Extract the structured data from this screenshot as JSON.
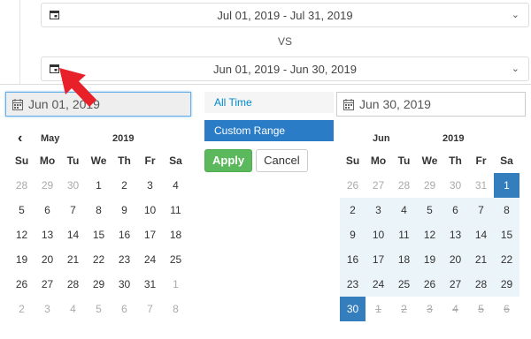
{
  "compare": {
    "range1": "Jul 01, 2019 - Jul 31, 2019",
    "vs": "VS",
    "range2": "Jun 01, 2019 - Jun 30, 2019"
  },
  "picker": {
    "start_input": "Jun 01, 2019",
    "end_input": "Jun 30, 2019",
    "ranges": [
      "All Time",
      "Custom Range"
    ],
    "apply_label": "Apply",
    "cancel_label": "Cancel",
    "left": {
      "month": "May",
      "year": "2019",
      "weekdays": [
        "Su",
        "Mo",
        "Tu",
        "We",
        "Th",
        "Fr",
        "Sa"
      ],
      "weeks": [
        [
          "28",
          "29",
          "30",
          "1",
          "2",
          "3",
          "4"
        ],
        [
          "5",
          "6",
          "7",
          "8",
          "9",
          "10",
          "11"
        ],
        [
          "12",
          "13",
          "14",
          "15",
          "16",
          "17",
          "18"
        ],
        [
          "19",
          "20",
          "21",
          "22",
          "23",
          "24",
          "25"
        ],
        [
          "26",
          "27",
          "28",
          "29",
          "30",
          "31",
          "1"
        ],
        [
          "2",
          "3",
          "4",
          "5",
          "6",
          "7",
          "8"
        ]
      ]
    },
    "right": {
      "month": "Jun",
      "year": "2019",
      "weekdays": [
        "Su",
        "Mo",
        "Tu",
        "We",
        "Th",
        "Fr",
        "Sa"
      ],
      "weeks": [
        [
          "26",
          "27",
          "28",
          "29",
          "30",
          "31",
          "1"
        ],
        [
          "2",
          "3",
          "4",
          "5",
          "6",
          "7",
          "8"
        ],
        [
          "9",
          "10",
          "11",
          "12",
          "13",
          "14",
          "15"
        ],
        [
          "16",
          "17",
          "18",
          "19",
          "20",
          "21",
          "22"
        ],
        [
          "23",
          "24",
          "25",
          "26",
          "27",
          "28",
          "29"
        ],
        [
          "30",
          "1",
          "2",
          "3",
          "4",
          "5",
          "6"
        ]
      ]
    }
  },
  "colors": {
    "accent": "#357ebd",
    "apply": "#5cb85c",
    "arrow": "#e8202a"
  },
  "icons": [
    "calendar-icon",
    "chevron-down-icon",
    "chevron-left-icon",
    "arrow-pointer-icon"
  ]
}
